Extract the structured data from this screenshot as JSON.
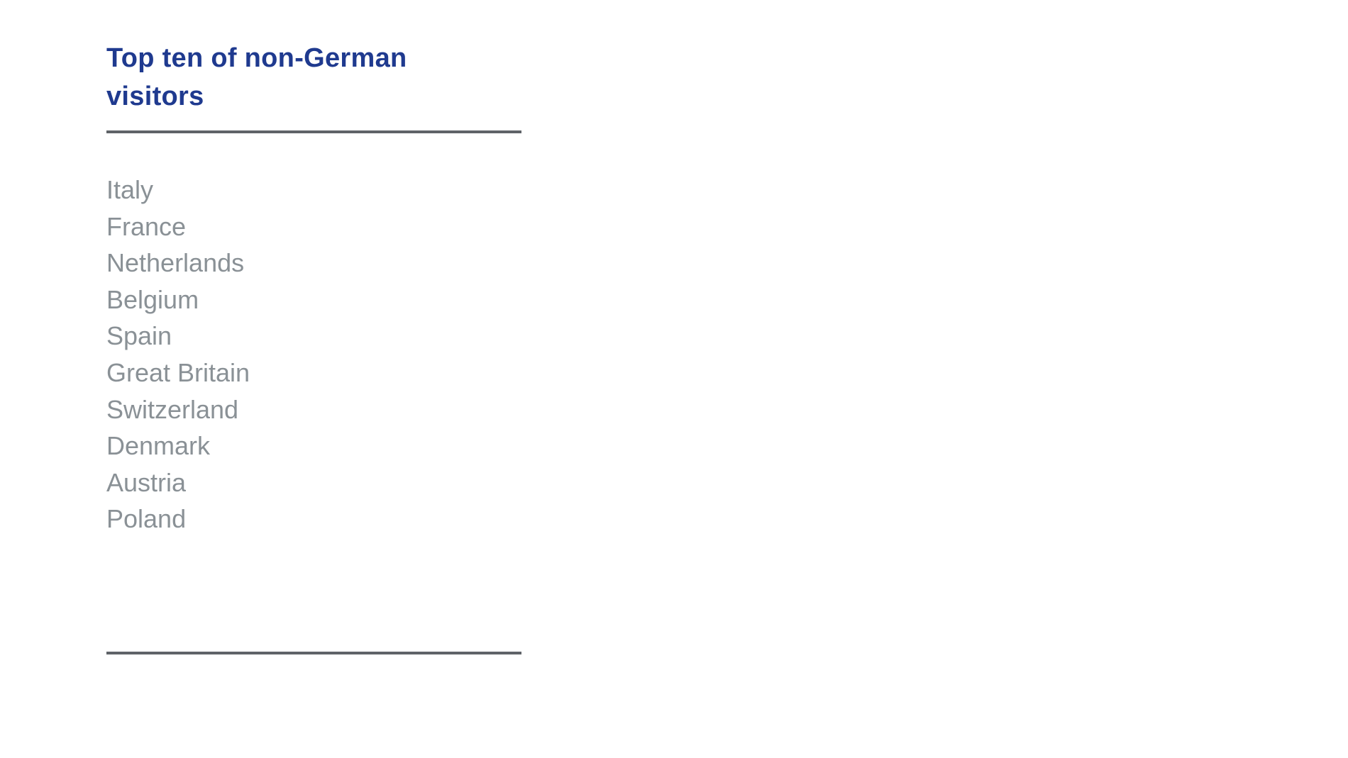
{
  "title": "Top ten of non-German visitors",
  "title_lines": [
    "Top ten of non-German",
    "visitors"
  ],
  "list": {
    "items": [
      "Italy",
      "France",
      "Netherlands",
      "Belgium",
      "Spain",
      "Great Britain",
      "Switzerland",
      "Denmark",
      "Austria",
      "Poland"
    ]
  },
  "colors": {
    "title": "#1f3a8f",
    "rule": "#5f6368",
    "list_text": "#8a9196",
    "background": "#ffffff"
  }
}
